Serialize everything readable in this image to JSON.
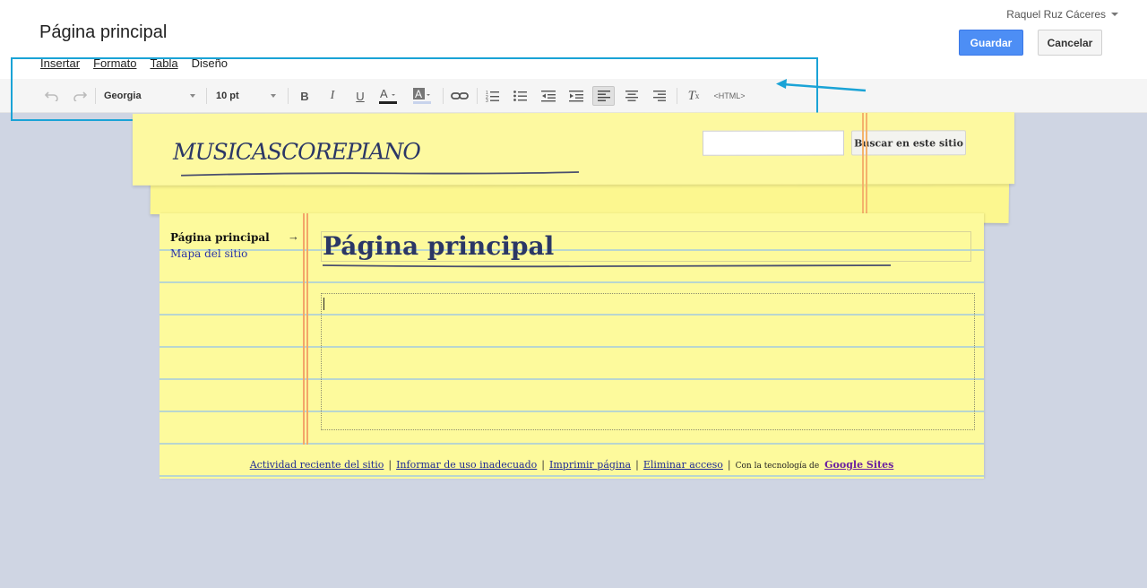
{
  "editor": {
    "page_title": "Página principal",
    "user_name": "Raquel Ruz Cáceres",
    "save_label": "Guardar",
    "cancel_label": "Cancelar",
    "menu": [
      {
        "label": "Insertar"
      },
      {
        "label": "Formato"
      },
      {
        "label": "Tabla"
      },
      {
        "label": "Diseño"
      }
    ],
    "toolbar": {
      "font": "Georgia",
      "size": "10 pt",
      "html_label": "<HTML>"
    }
  },
  "site": {
    "title": "MUSICASCOREPIANO",
    "search_button": "Buscar en este sitio",
    "search_value": "",
    "nav": {
      "current": "Página principal",
      "sitemap": "Mapa del sitio"
    },
    "page_title": "Página principal",
    "footer": {
      "links": [
        "Actividad reciente del sitio",
        "Informar de uso inadecuado",
        "Imprimir página",
        "Eliminar acceso"
      ],
      "powered_by": "Con la tecnología de",
      "brand": "Google Sites"
    }
  },
  "colors": {
    "accent_blue": "#4d8ef5",
    "annotation": "#1aa3d6",
    "paper": "#fdfa9c",
    "title_ink": "#2b3766"
  }
}
